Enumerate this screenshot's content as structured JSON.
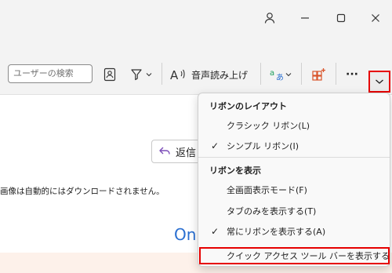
{
  "colors": {
    "accent_blue": "#2a6fd1",
    "highlight_red": "#e60000",
    "add_icon_orange": "#d9542b",
    "translate_green": "#1b9e5a"
  },
  "ribbon": {
    "search_placeholder": "ユーザーの検索",
    "read_aloud_label": "音声読み上げ",
    "more_label": "···"
  },
  "reading": {
    "reply_label": "返信",
    "message": "画像は自動的にはダウンロードされません。",
    "partial_text": "On"
  },
  "menu": {
    "section1_header": "リボンのレイアウト",
    "classic": "クラシック リボン(L)",
    "simple": "シンプル リボン(I)",
    "section2_header": "リボンを表示",
    "fullscreen": "全画面表示モード(F)",
    "tabs_only": "タブのみを表示する(T)",
    "always": "常にリボンを表示する(A)",
    "qat": "クイック アクセス ツール バーを表示する (S)",
    "check_glyph": "✓"
  }
}
